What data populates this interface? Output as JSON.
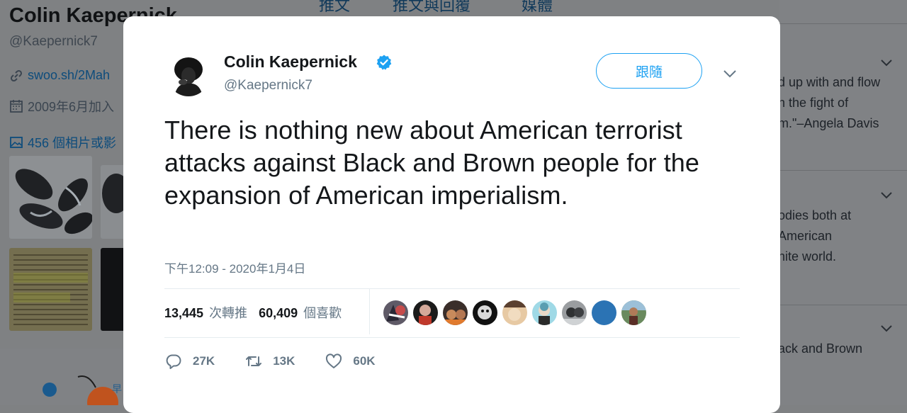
{
  "background": {
    "profile": {
      "name": "Colin Kaepernick",
      "handle": "@Kaepernick7",
      "link": "swoo.sh/2Mah",
      "joined": "2009年6月加入",
      "media": "456 個相片或影"
    },
    "tabs": [
      "推文",
      "推文與回覆",
      "媒體"
    ],
    "right_snippets": [
      "d up with and flow",
      "h the fight of",
      "m.\"–Angela Davis",
      "odies both at",
      "American",
      "nite world.",
      "ack and Brown"
    ]
  },
  "tweet": {
    "author_name": "Colin Kaepernick",
    "author_handle": "@Kaepernick7",
    "follow_label": "跟隨",
    "text": "There is nothing new about American terrorist attacks against Black and Brown people for the expansion of American imperialism.",
    "timestamp": "下午12:09 - 2020年1月4日",
    "retweets_count": "13,445",
    "retweets_label": "次轉推",
    "likes_count": "60,409",
    "likes_label": "個喜歡",
    "replies_action": "27K",
    "retweets_action": "13K",
    "likes_action": "60K"
  },
  "colors": {
    "accent": "#1da1f2",
    "text": "#14171a",
    "muted": "#657786",
    "overlay": "#7f8183"
  }
}
